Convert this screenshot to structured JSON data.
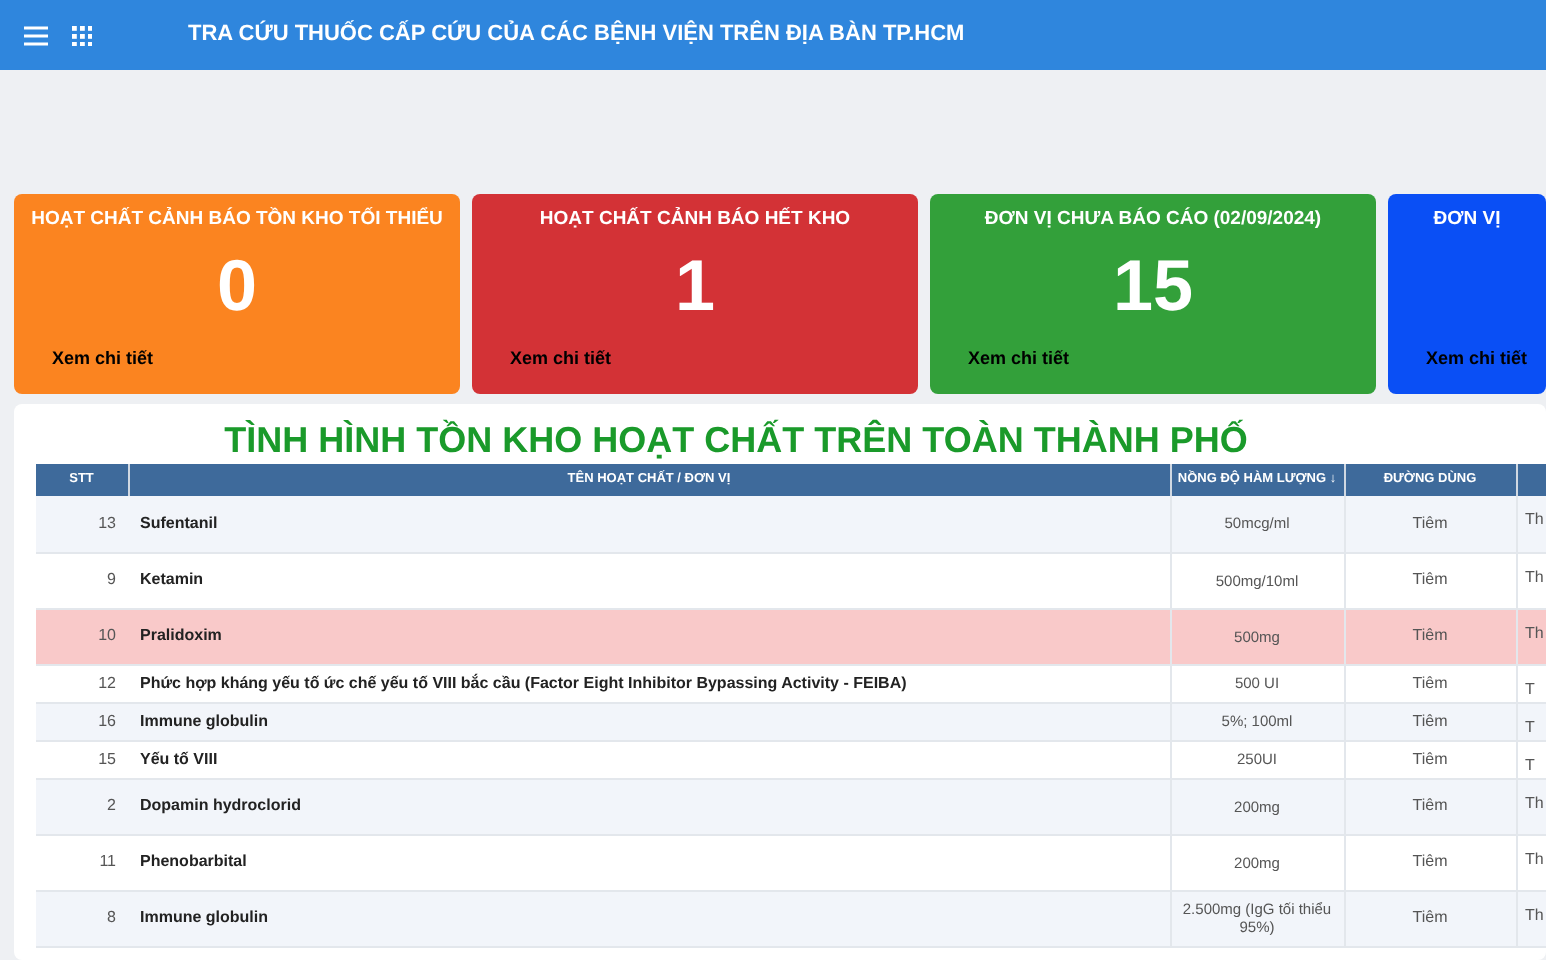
{
  "header": {
    "title": "TRA CỨU THUỐC CẤP CỨU CỦA CÁC BỆNH VIỆN TRÊN ĐỊA BÀN TP.HCM"
  },
  "cards": [
    {
      "title": "HOẠT CHẤT CẢNH BÁO TỒN KHO TỐI THIỂU",
      "value": "0",
      "link": "Xem chi tiết",
      "color": "#fb8420"
    },
    {
      "title": "HOẠT CHẤT CẢNH BÁO HẾT KHO",
      "value": "1",
      "link": "Xem chi tiết",
      "color": "#d33236"
    },
    {
      "title": "ĐƠN VỊ CHƯA BÁO CÁO (02/09/2024)",
      "value": "15",
      "link": "Xem chi tiết",
      "color": "#33a03a"
    },
    {
      "title": "ĐƠN VỊ",
      "link": "Xem chi tiết",
      "color": "#0a4ff5"
    }
  ],
  "section": {
    "title": "TÌNH HÌNH TỒN KHO HOẠT CHẤT TRÊN TOÀN THÀNH PHỐ"
  },
  "table": {
    "columns": [
      "STT",
      "TÊN HOẠT CHẤT / ĐƠN VỊ",
      "NỒNG ĐỘ HÀM LƯỢNG ↓",
      "ĐƯỜNG DÙNG"
    ],
    "rows": [
      {
        "stt": "13",
        "name": "Sufentanil",
        "strength": "50mcg/ml",
        "route": "Tiêm",
        "column_5": "Th",
        "highlighted": false,
        "tall": true
      },
      {
        "stt": "9",
        "name": "Ketamin",
        "strength": "500mg/10ml",
        "route": "Tiêm",
        "column_5": "Th",
        "highlighted": false,
        "tall": true
      },
      {
        "stt": "10",
        "name": "Pralidoxim",
        "strength": "500mg",
        "route": "Tiêm",
        "column_5": "Th",
        "highlighted": true,
        "tall": true
      },
      {
        "stt": "12",
        "name": "Phức hợp kháng yếu tố ức chế yếu tố VIII bắc cầu (Factor Eight Inhibitor Bypassing Activity - FEIBA)",
        "strength": "500 UI",
        "route": "Tiêm",
        "column_5": "T",
        "highlighted": false,
        "tall": false
      },
      {
        "stt": "16",
        "name": "Immune globulin",
        "strength": "5%; 100ml",
        "route": "Tiêm",
        "column_5": "T",
        "highlighted": false,
        "tall": false
      },
      {
        "stt": "15",
        "name": "Yếu tố VIII",
        "strength": "250UI",
        "route": "Tiêm",
        "column_5": "T",
        "highlighted": false,
        "tall": false
      },
      {
        "stt": "2",
        "name": "Dopamin hydroclorid",
        "strength": "200mg",
        "route": "Tiêm",
        "column_5": "Th",
        "highlighted": false,
        "tall": true
      },
      {
        "stt": "11",
        "name": "Phenobarbital",
        "strength": "200mg",
        "route": "Tiêm",
        "column_5": "Th",
        "highlighted": false,
        "tall": true
      },
      {
        "stt": "8",
        "name": "Immune globulin",
        "strength": "2.500mg (IgG tối thiểu 95%)",
        "route": "Tiêm",
        "column_5": "Th",
        "highlighted": false,
        "tall": true
      }
    ]
  }
}
